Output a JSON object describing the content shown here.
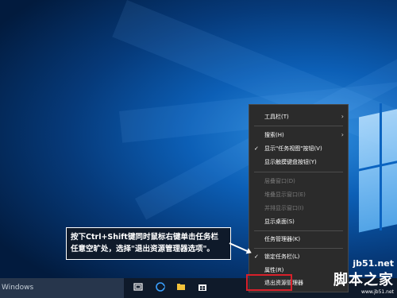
{
  "taskbar": {
    "search_text": "Windows",
    "icons": [
      "task-view-icon",
      "edge-icon",
      "file-explorer-icon",
      "store-icon"
    ]
  },
  "context_menu": {
    "items": [
      {
        "label": "工具栏(T)",
        "enabled": true,
        "submenu": true,
        "checked": false
      },
      {
        "label": "搜索(H)",
        "enabled": true,
        "submenu": true,
        "checked": false
      },
      {
        "label": "显示\"任务视图\"按钮(V)",
        "enabled": true,
        "submenu": false,
        "checked": true
      },
      {
        "label": "显示触摸键盘按钮(Y)",
        "enabled": true,
        "submenu": false,
        "checked": false
      },
      {
        "label": "层叠窗口(D)",
        "enabled": false,
        "submenu": false,
        "checked": false
      },
      {
        "label": "堆叠显示窗口(E)",
        "enabled": false,
        "submenu": false,
        "checked": false
      },
      {
        "label": "并排显示窗口(I)",
        "enabled": false,
        "submenu": false,
        "checked": false
      },
      {
        "label": "显示桌面(S)",
        "enabled": true,
        "submenu": false,
        "checked": false
      },
      {
        "label": "任务管理器(K)",
        "enabled": true,
        "submenu": false,
        "checked": false
      },
      {
        "label": "锁定任务栏(L)",
        "enabled": true,
        "submenu": false,
        "checked": true
      },
      {
        "label": "属性(R)",
        "enabled": true,
        "submenu": false,
        "checked": false
      },
      {
        "label": "退出资源管理器",
        "enabled": true,
        "submenu": false,
        "checked": false
      }
    ]
  },
  "annotation": {
    "line1": "按下Ctrl+Shift键同时鼠标右键单击任务栏",
    "line2": "任意空旷处，选择\"退出资源管理器选项\"。"
  },
  "watermark": {
    "top": "jb51.net",
    "main": "脚本之家",
    "sub": "www.jb51.net"
  },
  "colors": {
    "highlight": "#d8202a",
    "menu_bg": "#2b2b2b"
  }
}
